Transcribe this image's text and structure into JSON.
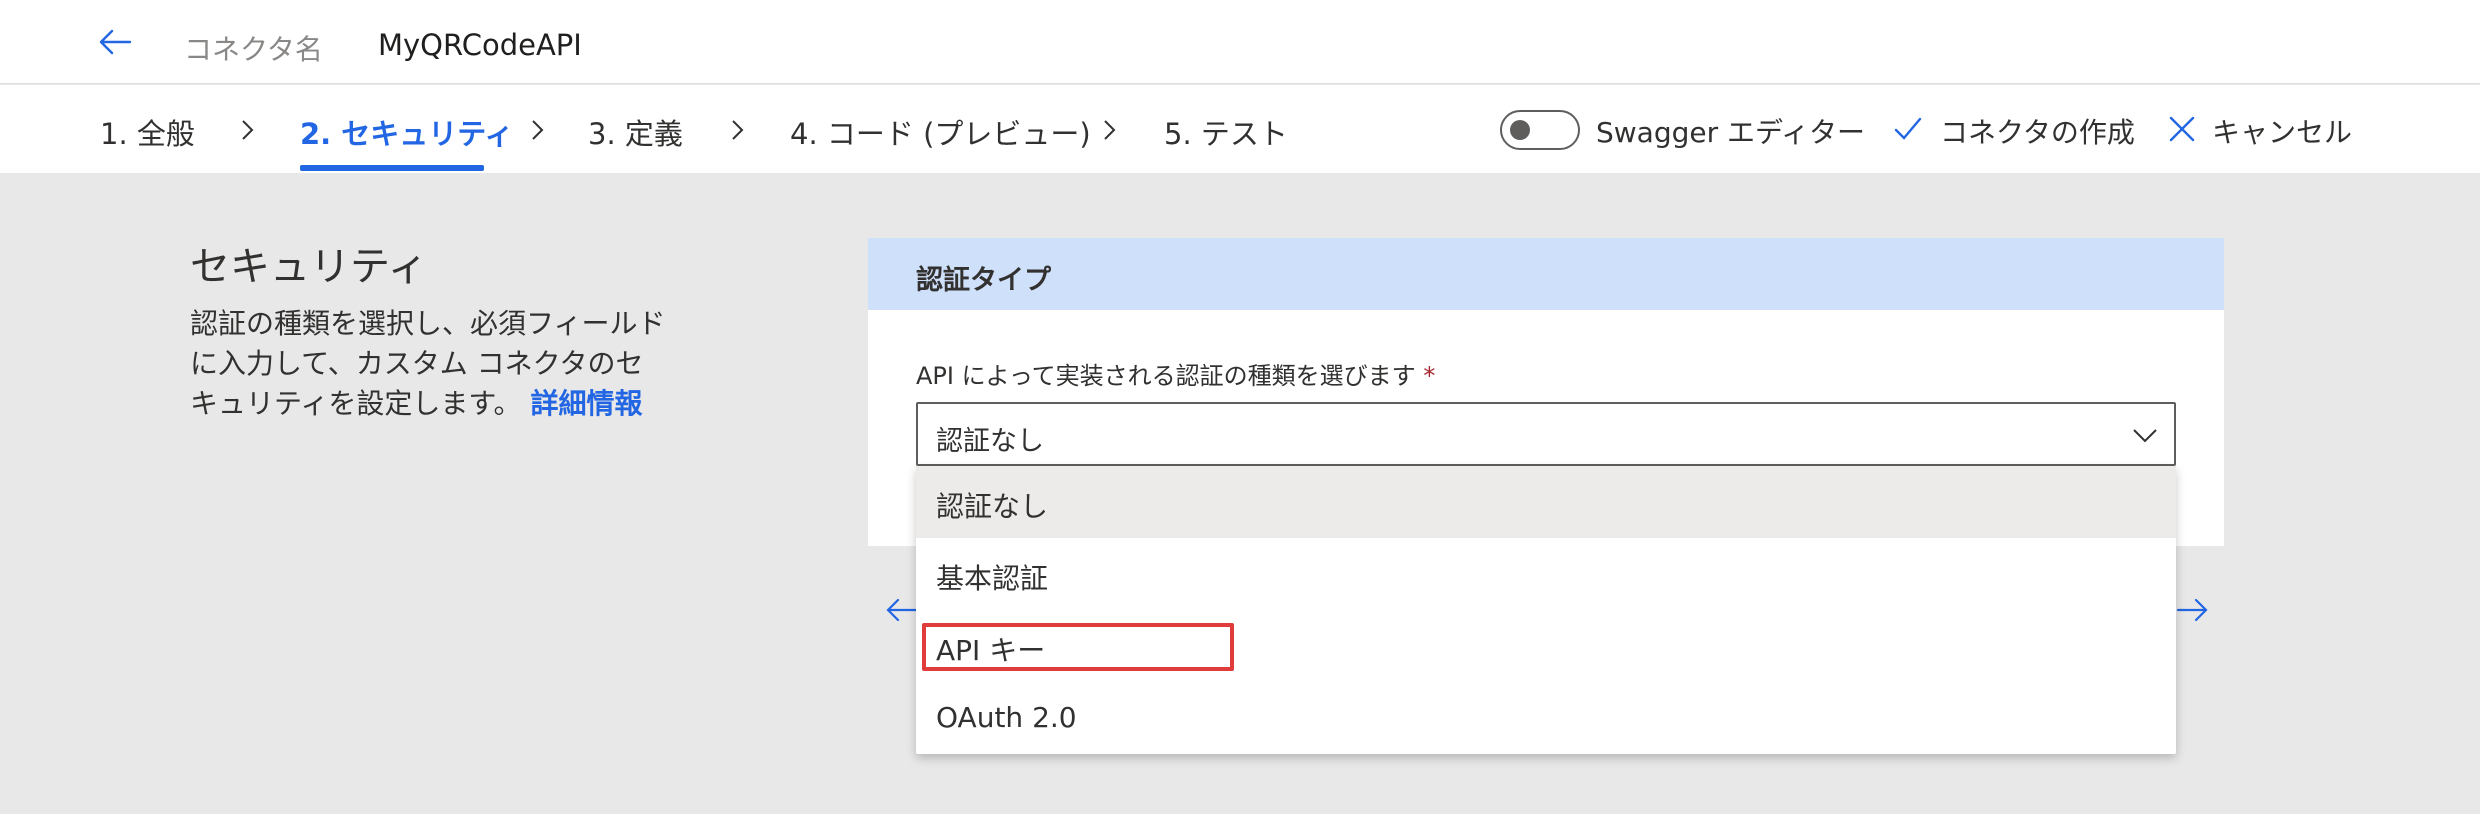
{
  "header": {
    "connector_label": "コネクタ名",
    "connector_name": "MyQRCodeAPI"
  },
  "steps": [
    {
      "label": "1. 全般"
    },
    {
      "label": "2. セキュリティ"
    },
    {
      "label": "3. 定義"
    },
    {
      "label": "4. コード (プレビュー)"
    },
    {
      "label": "5. テスト"
    }
  ],
  "active_step": "2. セキュリティ",
  "toolbar": {
    "swagger_label": "Swagger エディター",
    "swagger_enabled": false,
    "create_label": "コネクタの作成",
    "cancel_label": "キャンセル"
  },
  "security": {
    "title": "セキュリティ",
    "description": "認証の種類を選択し、必須フィールドに入力して、カスタム コネクタのセキュリティを設定します。",
    "more_info_link": "詳細情報"
  },
  "auth_card": {
    "header": "認証タイプ",
    "field_label": "API によって実装される認証の種類を選びます",
    "required_marker": "*",
    "selected_value": "認証なし",
    "options": [
      {
        "label": "認証なし"
      },
      {
        "label": "基本認証"
      },
      {
        "label": "API キー"
      },
      {
        "label": "OAuth 2.0"
      }
    ],
    "highlighted_option": "API キー"
  },
  "colors": {
    "accent": "#2266e3",
    "card_header_bg": "#cfe0fa",
    "highlight_border": "#e03c3c",
    "page_bg": "#e8e8e8"
  },
  "icons": [
    "back-arrow-icon",
    "chevron-right-icon",
    "checkmark-icon",
    "close-icon",
    "chevron-down-icon",
    "arrow-left-icon",
    "arrow-right-icon"
  ]
}
